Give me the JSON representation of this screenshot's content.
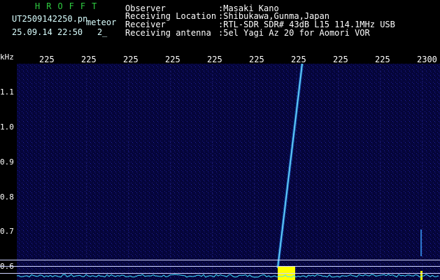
{
  "app": {
    "logo": "HROFFT",
    "filename": "UT2509142250.pn",
    "mode": "meteor",
    "datetime": "25.09.14 22:50",
    "count": "2",
    "count_suffix": "_"
  },
  "info": {
    "rows": [
      {
        "label": "Observer",
        "value": ":Masaki Kano"
      },
      {
        "label": "Receiving Location",
        "value": ":Shibukawa,Gunma,Japan"
      },
      {
        "label": "Receiver",
        "value": ":RTL-SDR SDR# 43dB L15 114.1MHz USB"
      },
      {
        "label": "Receiving antenna",
        "value": ":5el Yagi Az 20 for Aomori VOR"
      }
    ]
  },
  "spectrogram": {
    "unit_label": "kHz",
    "time_ticks": [
      "225",
      "225",
      "225",
      "225",
      "225",
      "225",
      "225",
      "225",
      "225",
      "2300"
    ],
    "freq_ticks": [
      "1.1",
      "1.0",
      "0.9",
      "0.8",
      "0.7",
      "0.6"
    ],
    "background_color": "#05053a",
    "trace_color": "#38c8ff",
    "peak_color": "#ffff00"
  }
}
